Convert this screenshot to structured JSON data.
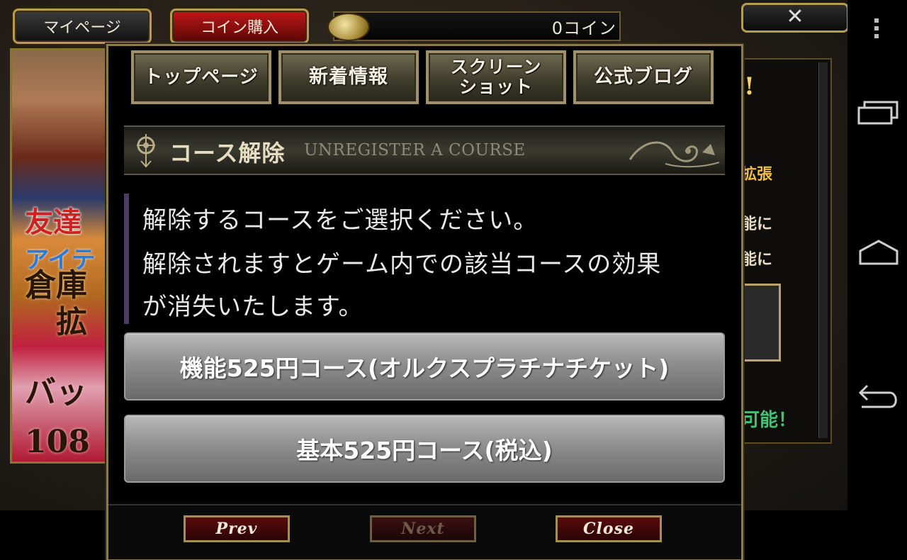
{
  "game": {
    "mypage_label": "マイページ",
    "buy_coin_label": "コイン購入",
    "coin_balance": "0コイン",
    "close_x": "✕",
    "left_banner": {
      "friend_text": "友達",
      "item_text": "アイテ",
      "warehouse_text": "倉庫\n　拡",
      "bag_text": "バッ\n108"
    },
    "right_panel": {
      "exclamation": "!",
      "expand_text": "拡張",
      "func_text_1": "能に",
      "func_text_2": "能に",
      "possible_text": "可能！"
    }
  },
  "modal": {
    "tabs": [
      {
        "label": "トップページ"
      },
      {
        "label": "新着情報"
      },
      {
        "label": "スクリーン\nショット"
      },
      {
        "label": "公式ブログ"
      }
    ],
    "header": {
      "title_ja": "コース解除",
      "title_en": "UNREGISTER A COURSE"
    },
    "description": [
      "解除するコースをご選択ください。",
      "解除されますとゲーム内での該当コースの効果",
      "が消失いたします。"
    ],
    "courses": [
      {
        "label": "機能525円コース(オルクスプラチナチケット)"
      },
      {
        "label": "基本525円コース(税込)"
      }
    ],
    "footer": {
      "prev_label": "Prev",
      "next_label": "Next",
      "close_label": "Close",
      "next_enabled": false
    }
  },
  "android_nav": {
    "icons": [
      "menu-dots-icon",
      "recent-apps-icon",
      "home-icon",
      "back-icon"
    ]
  }
}
